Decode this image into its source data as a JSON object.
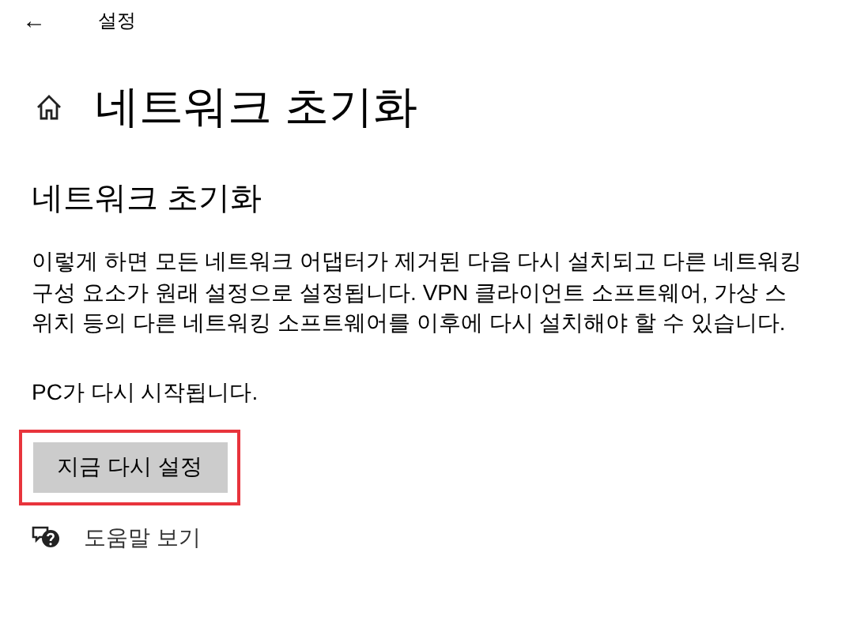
{
  "title_bar": {
    "back": "←",
    "title": "설정"
  },
  "page_title": "네트워크 초기화",
  "section_title": "네트워크 초기화",
  "description": "이렇게 하면 모든 네트워크 어댑터가 제거된 다음 다시 설치되고 다른 네트워킹 구성 요소가 원래 설정으로 설정됩니다. VPN 클라이언트 소프트웨어, 가상 스위치 등의 다른 네트워킹 소프트웨어를 이후에 다시 설치해야 할 수 있습니다.",
  "restart_note": "PC가 다시 시작됩니다.",
  "reset_button": {
    "label": "지금 다시 설정",
    "highlighted": true
  },
  "help_link": "도움말 보기"
}
